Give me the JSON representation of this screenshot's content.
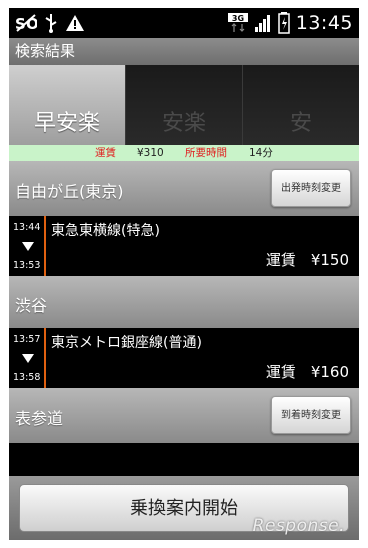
{
  "status_bar": {
    "network_label": "3G",
    "time": "13:45",
    "icons": [
      "no-signal-icon",
      "usb-icon",
      "warning-icon",
      "3g-icon",
      "signal-bars-icon",
      "battery-icon"
    ]
  },
  "title": "検索結果",
  "tabs": [
    {
      "label": "早安楽",
      "active": true
    },
    {
      "label": "安楽",
      "active": false
    },
    {
      "label": "安",
      "active": false
    }
  ],
  "summary": {
    "fare_label": "運賃",
    "fare_value": "¥310",
    "time_label": "所要時間",
    "time_value": "14分"
  },
  "route": {
    "origin": {
      "name": "自由が丘(東京)",
      "button": "出発時刻変更"
    },
    "segment1": {
      "depart": "13:44",
      "arrive": "13:53",
      "line": "東急東横線(特急)",
      "fare": "運賃　¥150"
    },
    "transfer": {
      "name": "渋谷"
    },
    "segment2": {
      "depart": "13:57",
      "arrive": "13:58",
      "line": "東京メトロ銀座線(普通)",
      "fare": "運賃　¥160"
    },
    "destination": {
      "name": "表参道",
      "button": "到着時刻変更"
    }
  },
  "start_button": "乗換案内開始",
  "watermark": "Response."
}
